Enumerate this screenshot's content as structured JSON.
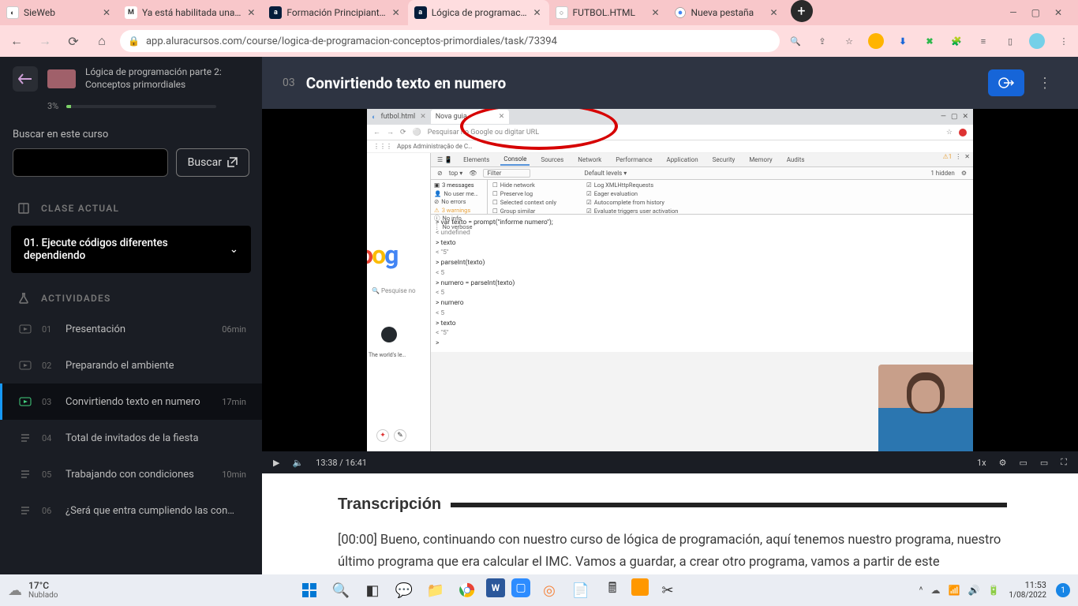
{
  "browser": {
    "tabs": [
      {
        "title": "SieWeb"
      },
      {
        "title": "Ya está habilitada una…"
      },
      {
        "title": "Formación Principiant…"
      },
      {
        "title": "Lógica de programac…",
        "active": true
      },
      {
        "title": "FUTBOL.HTML"
      },
      {
        "title": "Nueva pestaña"
      }
    ],
    "url": "app.aluracursos.com/course/logica-de-programacion-conceptos-primordiales/task/73394"
  },
  "course": {
    "title": "Lógica de programación parte 2:",
    "subtitle": "Conceptos primordiales",
    "progress_pct": "3%",
    "progress_val": 3
  },
  "search": {
    "label": "Buscar en este curso",
    "button": "Buscar"
  },
  "sections": {
    "current": "CLASE ACTUAL",
    "activities": "ACTIVIDADES"
  },
  "module": {
    "label": "01. Ejecute códigos diferentes dependiendo"
  },
  "activities": [
    {
      "num": "01",
      "label": "Presentación",
      "dur": "06min",
      "icon": "video",
      "active": false
    },
    {
      "num": "02",
      "label": "Preparando el ambiente",
      "dur": "",
      "icon": "video",
      "active": false
    },
    {
      "num": "03",
      "label": "Convirtiendo texto en numero",
      "dur": "17min",
      "icon": "video",
      "active": true
    },
    {
      "num": "04",
      "label": "Total de invitados de la fiesta",
      "dur": "",
      "icon": "text",
      "active": false
    },
    {
      "num": "05",
      "label": "Trabajando con condiciones",
      "dur": "10min",
      "icon": "text",
      "active": false
    },
    {
      "num": "06",
      "label": "¿Será que entra cumpliendo las condici…",
      "dur": "",
      "icon": "text",
      "active": false
    }
  ],
  "lesson": {
    "num": "03",
    "title": "Convirtiendo texto en numero"
  },
  "video": {
    "time_current": "13:38",
    "time_total": "16:41",
    "time_combined": "13:38  /  16:41",
    "speed": "1x",
    "mini_tab1": "futbol.html",
    "mini_tab2": "Nova guia",
    "mini_addr": "Pesquisar no Google ou digitar URL",
    "mini_bookmarks": "Apps    Administração de C…",
    "dt_tabs": [
      "Elements",
      "Console",
      "Sources",
      "Network",
      "Performance",
      "Application",
      "Security",
      "Memory",
      "Audits"
    ],
    "dt_hidden": "1 hidden",
    "dt_default": "Default levels ▾",
    "dt_msgs_heading": "3 messages",
    "dt_msgs": [
      "No user me…",
      "No errors",
      "3 warnings",
      "No info",
      "No verbose"
    ],
    "dt_checks_left": [
      "Hide network",
      "Preserve log",
      "Selected context only",
      "Group similar"
    ],
    "dt_checks_right": [
      "Log XMLHttpRequests",
      "Eager evaluation",
      "Autocomplete from history",
      "Evaluate triggers user activation"
    ],
    "console_lines": [
      "> var texto = prompt(\"informe numero\");",
      "< undefined",
      "> texto",
      "< \"5\"",
      "> parseInt(texto)",
      "< 5",
      "> numero = parseInt(texto)",
      "< 5",
      "> numero",
      "< 5",
      "> texto",
      "< \"5\"",
      ">"
    ],
    "gh_caption": "The world's le…"
  },
  "transcript": {
    "heading": "Transcripción",
    "body": "[00:00] Bueno, continuando con nuestro curso de lógica de programación, aquí tenemos nuestro programa, nuestro último programa que era calcular el IMC. Vamos a guardar, a crear otro programa, vamos a partir de este"
  },
  "taskbar": {
    "temp": "17°C",
    "cond": "Nublado",
    "time": "11:53",
    "date": "1/08/2022",
    "notif": "1"
  }
}
